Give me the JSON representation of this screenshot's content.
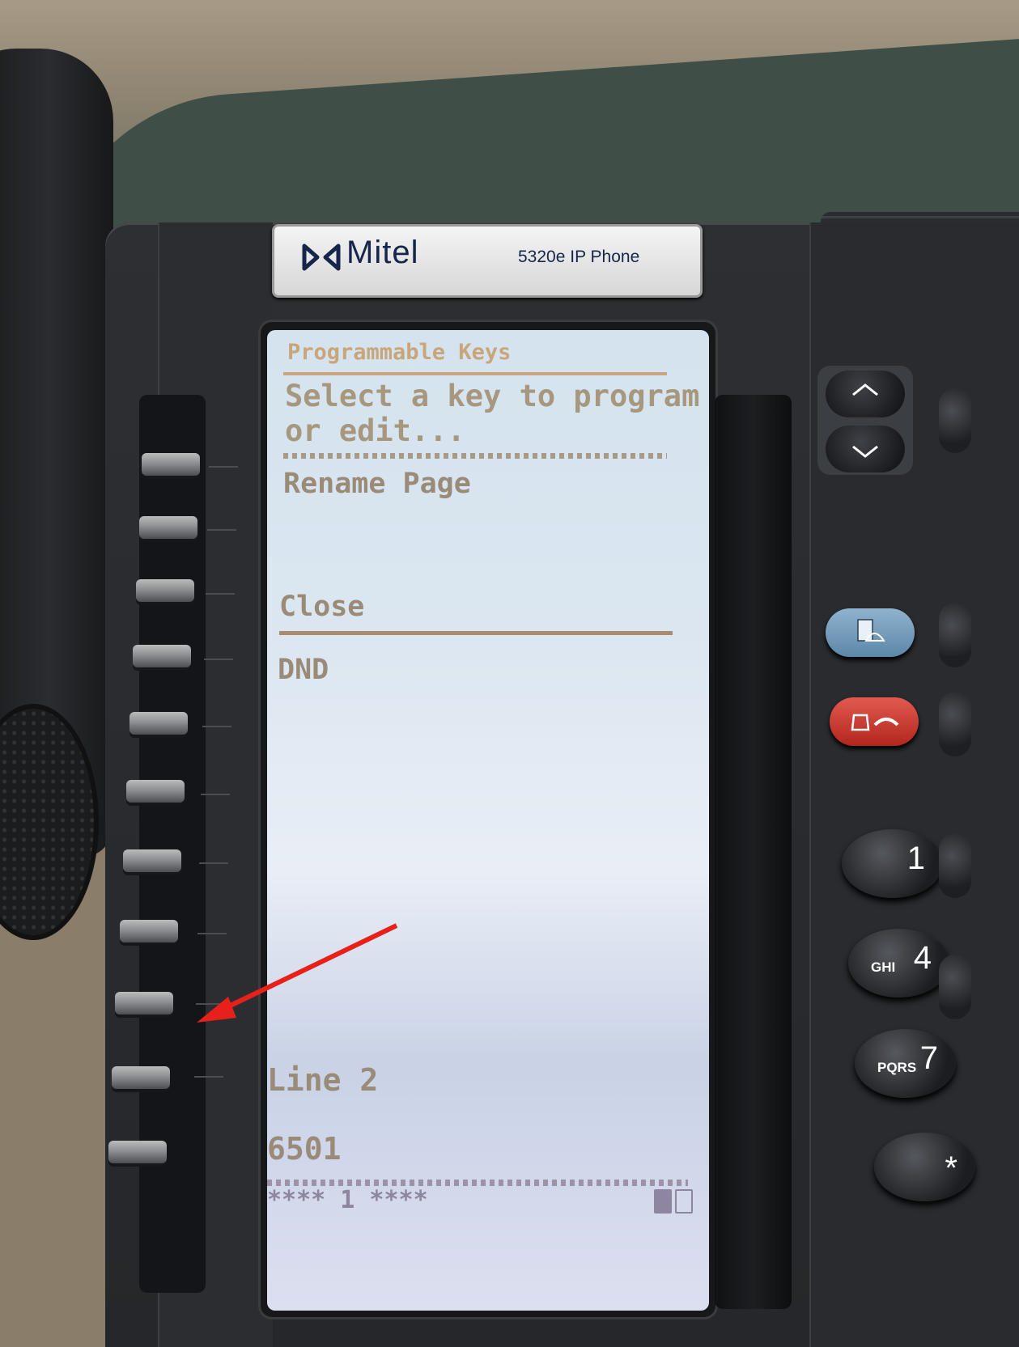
{
  "brand": {
    "name": "Mitel",
    "model": "5320e IP Phone"
  },
  "screen": {
    "header": "Programmable Keys",
    "prompt_line1": "Select a key to program",
    "prompt_line2": "or edit...",
    "items": {
      "rename_page": "Rename Page",
      "close": "Close",
      "dnd": "DND",
      "line2": "Line 2",
      "extension": "6501"
    },
    "page_indicator": "**** 1 ****"
  },
  "keypad": {
    "key1": {
      "digit": "1",
      "letters": ""
    },
    "key4": {
      "digit": "4",
      "letters": "GHI"
    },
    "key7": {
      "digit": "7",
      "letters": "PQRS"
    },
    "key_star": {
      "digit": "*",
      "letters": ""
    }
  },
  "annotation": {
    "arrow_color": "#e8201a"
  },
  "colors": {
    "lcd_header": "#c8a57a",
    "lcd_text": "#9a8b79",
    "voicemail_button": "#6f97b8",
    "release_button": "#c8372c"
  }
}
